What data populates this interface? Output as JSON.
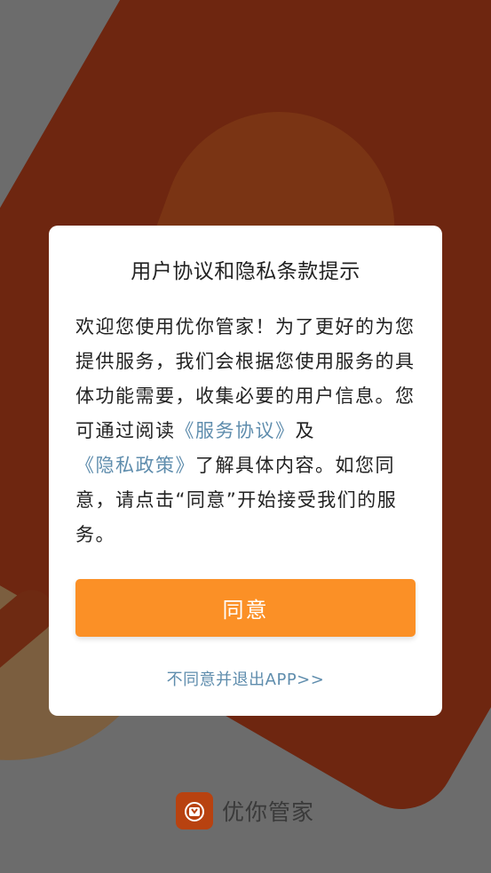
{
  "dialog": {
    "title": "用户协议和隐私条款提示",
    "body": {
      "part1": "欢迎您使用优你管家！为了更好的为您提供服务，我们会根据您使用服务的具体功能需要，收集必要的用户信息。您可通过阅读",
      "service_agreement_link": "《服务协议》",
      "and": "及",
      "privacy_policy_link": "《隐私政策》",
      "part2": "了解具体内容。如您同意，请点击“同意”开始接受我们的服务。"
    },
    "agree_label": "同意",
    "disagree_label": "不同意并退出APP>>"
  },
  "brand": {
    "name": "优你管家",
    "icon": "app-logo-icon"
  },
  "colors": {
    "accent": "#fb9026",
    "link": "#5f8dad",
    "brand": "#b84210"
  }
}
